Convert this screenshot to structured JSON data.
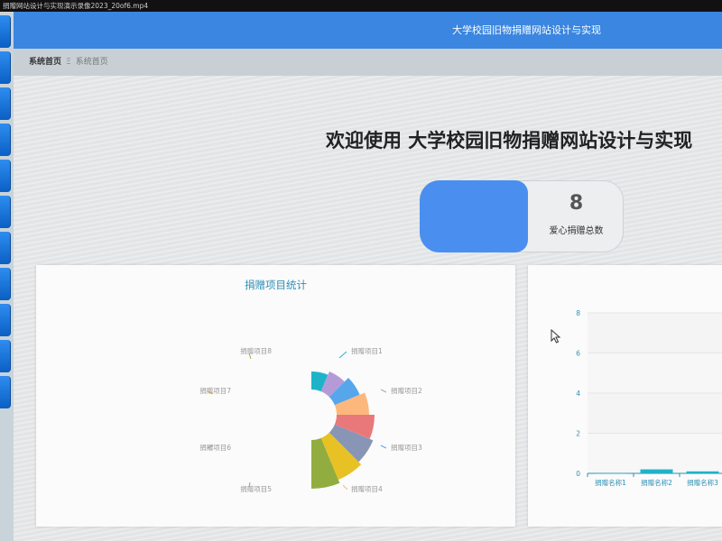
{
  "video_title": "捐赠网站设计与实现演示录像2023_20of6.mp4",
  "header": {
    "title": "大学校园旧物捐赠网站设计与实现"
  },
  "breadcrumb": {
    "root": "系统首页",
    "separator": "Ξ",
    "current": "系统首页"
  },
  "welcome": "欢迎使用 大学校园旧物捐赠网站设计与实现",
  "stat": {
    "value": "8",
    "label": "爱心捐赠总数",
    "accent": "#4a8ff0"
  },
  "chart_data": [
    {
      "type": "pie",
      "title": "捐赠项目统计",
      "categories": [
        "捐赠项目1",
        "捐赠项目2",
        "捐赠项目3",
        "捐赠项目4",
        "捐赠项目5",
        "捐赠项目6",
        "捐赠项目7",
        "捐赠项目8"
      ],
      "values": [
        1,
        1,
        1,
        1,
        1,
        1,
        1,
        1
      ],
      "colors": [
        "#1fb3c9",
        "#b59ad8",
        "#56a6ec",
        "#fcb87c",
        "#e9787b",
        "#8995b4",
        "#e8c224",
        "#92ad3f"
      ],
      "style": "half-rose"
    },
    {
      "type": "bar",
      "title": "",
      "categories": [
        "捐赠名称1",
        "捐赠名称2",
        "捐赠名称3"
      ],
      "values": [
        0,
        0.2,
        0.1
      ],
      "ylim": [
        0,
        8
      ],
      "yticks": [
        0,
        2,
        4,
        6,
        8
      ],
      "color": "#1fb3c9"
    }
  ]
}
